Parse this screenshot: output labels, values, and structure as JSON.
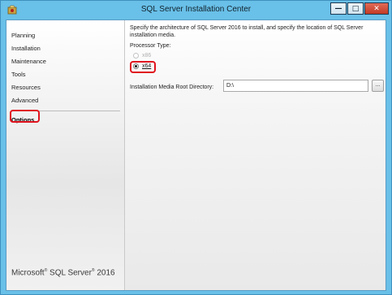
{
  "window": {
    "title": "SQL Server Installation Center",
    "controls": {
      "minimize": "—",
      "maximize": "□",
      "close": "✕"
    }
  },
  "sidebar": {
    "items": [
      {
        "label": "Planning"
      },
      {
        "label": "Installation"
      },
      {
        "label": "Maintenance"
      },
      {
        "label": "Tools"
      },
      {
        "label": "Resources"
      },
      {
        "label": "Advanced"
      }
    ],
    "selected": {
      "label": "Options"
    },
    "brand": {
      "name": "Microsoft",
      "reg": "®",
      "product": " SQL Server",
      "year": " 2016"
    }
  },
  "main": {
    "description": "Specify the architecture of SQL Server 2016 to install, and specify the location of SQL Server installation media.",
    "processor_type_label": "Processor Type:",
    "options": [
      {
        "label": "x86",
        "selected": false,
        "enabled": false
      },
      {
        "label": "x64",
        "selected": true,
        "enabled": true
      }
    ],
    "media_root_label": "Installation Media Root Directory:",
    "media_root_value": "D:\\",
    "browse_label": "..."
  },
  "colors": {
    "titlebar": "#69c0e8",
    "highlight": "#e0141e",
    "close_button": "#c23b25"
  }
}
